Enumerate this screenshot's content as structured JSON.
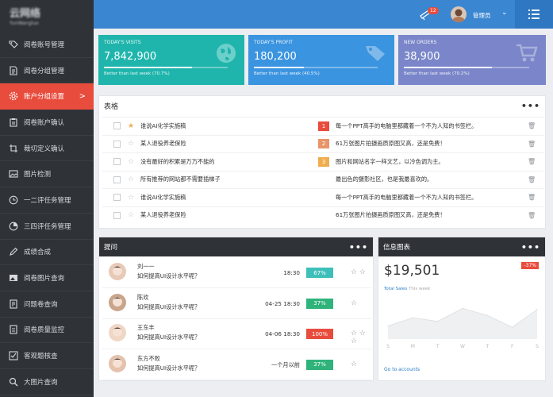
{
  "sidebar": {
    "logo_line1": "云网络",
    "logo_line2": "YunWangluo",
    "items": [
      {
        "label": "阅卷账号管理",
        "icon": "tag-icon"
      },
      {
        "label": "阅卷分组管理",
        "icon": "file-icon"
      },
      {
        "label": "账户分组设置",
        "icon": "gear-icon",
        "active": true
      },
      {
        "label": "阅卷账户确认",
        "icon": "clipboard-icon"
      },
      {
        "label": "裁切定义确认",
        "icon": "crop-icon"
      },
      {
        "label": "图片检测",
        "icon": "image-icon"
      },
      {
        "label": "一二评任务管理",
        "icon": "clock-icon"
      },
      {
        "label": "三四评任务管理",
        "icon": "pie-icon"
      },
      {
        "label": "成绩合成",
        "icon": "pencil-icon"
      },
      {
        "label": "阅卷图片查询",
        "icon": "picture-icon"
      },
      {
        "label": "问题卷查询",
        "icon": "document-icon"
      },
      {
        "label": "阅卷质量监控",
        "icon": "monitor-icon"
      },
      {
        "label": "客观题核查",
        "icon": "check-icon"
      },
      {
        "label": "大图片查询",
        "icon": "search-icon"
      }
    ],
    "active_chevron": ">"
  },
  "topbar": {
    "notification_count": "12",
    "username": "管理员"
  },
  "stats": [
    {
      "title": "TODAY'S VISITS",
      "value": "7,842,900",
      "footer": "Better than last week (70.7%)",
      "progress": 0.707,
      "icon": "globe-icon",
      "color": "#1fb5ac"
    },
    {
      "title": "TODAY'S PROFIT",
      "value": "180,200",
      "footer": "Better than last week (40.5%)",
      "progress": 0.405,
      "icon": "tag-icon",
      "color": "#3b94e0"
    },
    {
      "title": "NEW ORDERS",
      "value": "38,900",
      "footer": "Better than last week (70.2%)",
      "progress": 0.702,
      "icon": "cart-icon",
      "color": "#7a86c9"
    }
  ],
  "tasks": {
    "title": "表格",
    "rows": [
      {
        "text": "谁说AI化学实施稿",
        "starred": true,
        "num": "1",
        "num_color": "#e84c3d",
        "desc": "每一个PPT高手的电脑里都藏着一个不为人知的书签栏。"
      },
      {
        "text": "某人退役养老保险",
        "starred": false,
        "num": "2",
        "num_color": "#e8956a",
        "desc": "61万张图片拍摄画质原图又高，还是免费！"
      },
      {
        "text": "没有最好的积累是万万不能的",
        "starred": false,
        "num": "3",
        "num_color": "#f0ad4e",
        "desc": "图片和网站名字一样文艺，以冷色调为主。"
      },
      {
        "text": "所有推荐的网站都不需要插梯子",
        "starred": false,
        "num": "",
        "num_color": "",
        "desc": "最出色的摄影社区，也是我最喜欢的。"
      },
      {
        "text": "谁说AI化学实施稿",
        "starred": false,
        "num": "",
        "num_color": "",
        "desc": "每一个PPT高手的电脑里都藏着一个不为人知的书签栏。"
      },
      {
        "text": "某人退役养老保险",
        "starred": false,
        "num": "",
        "num_color": "",
        "desc": "61万张图片拍摄画质原图又高，还是免费！"
      }
    ]
  },
  "questions": {
    "title": "提问",
    "rows": [
      {
        "name": "刘一一",
        "question": "如何提高UI设计水平呢？",
        "time": "18:30",
        "percent": "67%",
        "badge_color": "#3fbfb9",
        "actions": "☆ ☆"
      },
      {
        "name": "陈欢",
        "question": "如何提高UI设计水平呢？",
        "time": "04-25  18:30",
        "percent": "37%",
        "badge_color": "#2fb37a",
        "actions": "☆"
      },
      {
        "name": "王东丰",
        "question": "如何提高UI设计水平呢？",
        "time": "04-06  18:30",
        "percent": "100%",
        "badge_color": "#e84c3d",
        "actions": "☆ ☆ ☆"
      },
      {
        "name": "东方不败",
        "question": "如何提高UI设计水平呢？",
        "time": "一个月以前",
        "percent": "37%",
        "badge_color": "#2fb37a",
        "actions": "☆"
      }
    ]
  },
  "sales": {
    "title": "信息图表",
    "amount": "$19,501",
    "change": "-37%",
    "label": "Total Sales",
    "period": "This week",
    "link": "Go to accounts"
  },
  "chart_data": {
    "type": "area",
    "categories": [
      "S",
      "M",
      "T",
      "W",
      "T",
      "F",
      "S"
    ],
    "values": [
      22,
      36,
      30,
      52,
      40,
      20,
      50
    ],
    "ylim": [
      0,
      70
    ],
    "grid": false
  }
}
